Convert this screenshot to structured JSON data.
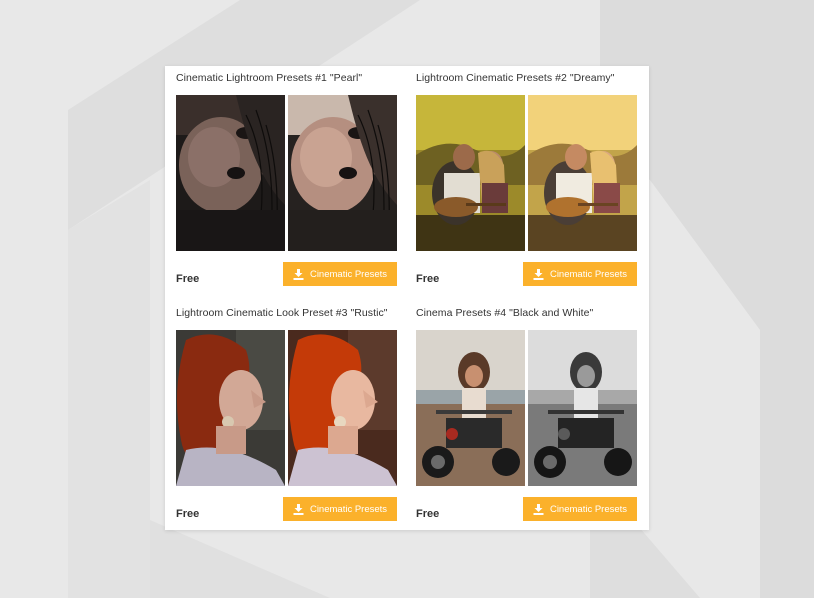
{
  "page": {
    "accent_color": "#fbb12b",
    "background_color": "#e8e8e8"
  },
  "presets": [
    {
      "title": "Cinematic Lightroom Presets #1 \"Pearl\"",
      "price": "Free",
      "button_label": "Cinematic Presets",
      "button_icon": "download-icon",
      "photo_subject": "woman-portrait-lying"
    },
    {
      "title": "Lightroom Cinematic Presets #2 \"Dreamy\"",
      "price": "Free",
      "button_label": "Cinematic Presets",
      "button_icon": "download-icon",
      "photo_subject": "couple-with-guitar-sunset"
    },
    {
      "title": "Lightroom Cinematic Look Preset #3 \"Rustic\"",
      "price": "Free",
      "button_label": "Cinematic Presets",
      "button_icon": "download-icon",
      "photo_subject": "red-haired-woman-profile"
    },
    {
      "title": "Cinema Presets #4 \"Black and White\"",
      "price": "Free",
      "button_label": "Cinematic Presets",
      "button_icon": "download-icon",
      "photo_subject": "woman-on-motorcycle"
    }
  ]
}
